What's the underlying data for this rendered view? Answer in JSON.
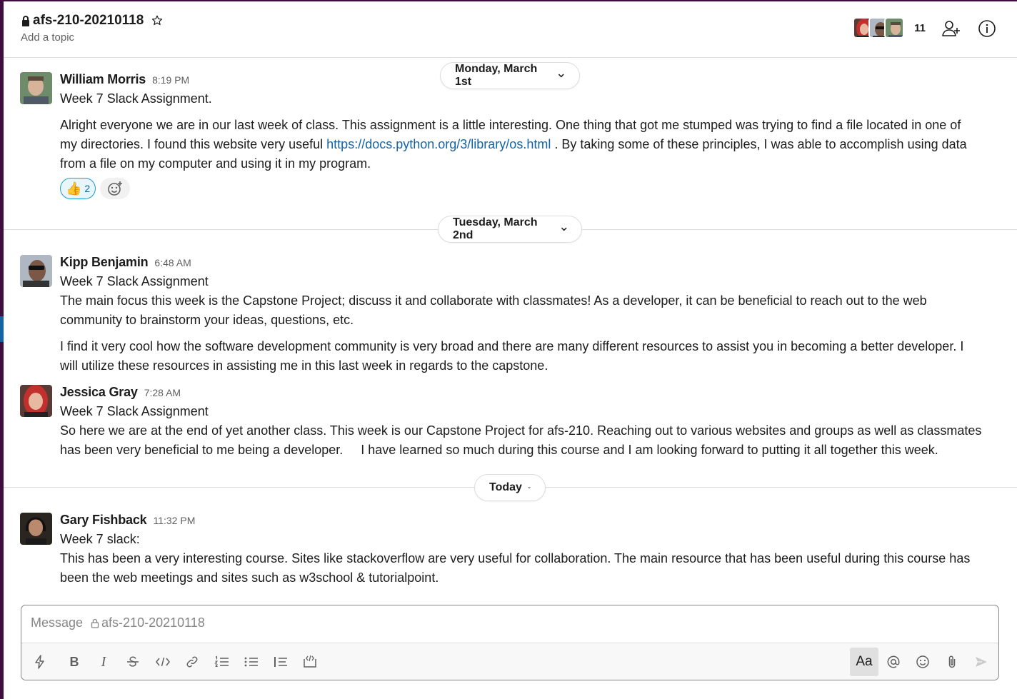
{
  "channel": {
    "name": "afs-210-20210118",
    "topic": "Add a topic"
  },
  "header": {
    "member_count": "11"
  },
  "dates": {
    "d1": "Monday, March 1st",
    "d2": "Tuesday, March 2nd",
    "d3": "Today"
  },
  "messages": [
    {
      "author": "William Morris",
      "time": "8:19 PM",
      "title": "Week 7 Slack Assignment.",
      "p1": "Alright everyone we are in our last week of class. This assignment is a little interesting. One thing that got me stumped was trying to find a file located in one of",
      "p2a": "my directories. I found this website very useful ",
      "link": "https://docs.python.org/3/library/os.html",
      "p2b": " . By taking some of these principles, I was able to accomplish using data",
      "p3": "from a file on my computer and using it in my program.",
      "reaction_emoji": "👍",
      "reaction_count": "2"
    },
    {
      "author": "Kipp Benjamin",
      "time": "6:48 AM",
      "title": "Week 7 Slack Assignment",
      "p1": "The main focus this week is the Capstone Project; discuss it and collaborate with classmates! As a developer, it can be beneficial to reach out to the web",
      "p2": "community to brainstorm your ideas, questions, etc.",
      "p3": "I find it very cool how the software development community is very broad and there are many different resources to assist you in becoming a better developer. I",
      "p4": "will utilize these resources in assisting me in this last week in regards to the capstone."
    },
    {
      "author": "Jessica Gray",
      "time": "7:28 AM",
      "title": "Week 7 Slack Assignment",
      "p1": "So here we are at the end of yet another class. This week is our Capstone Project for afs-210. Reaching out to various websites and groups as well as classmates",
      "p2": "has been very beneficial to me being a developer.     I have learned so much during this course and I am looking forward to putting it all together this week."
    },
    {
      "author": "Gary Fishback",
      "time": "11:32 PM",
      "title": "Week 7 slack:",
      "p1": "This has been a very interesting course. Sites like stackoverflow are very useful for collaboration. The main resource that has been useful during this course has",
      "p2": "been the web meetings and sites such as w3school & tutorialpoint."
    }
  ],
  "composer": {
    "placeholder_prefix": "Message ",
    "placeholder_channel": "afs-210-20210118",
    "format_label": "Aa"
  },
  "colors": {
    "sidebar": "#3f0e40",
    "link": "#1264a3",
    "reaction_border": "#1d9bd1"
  }
}
